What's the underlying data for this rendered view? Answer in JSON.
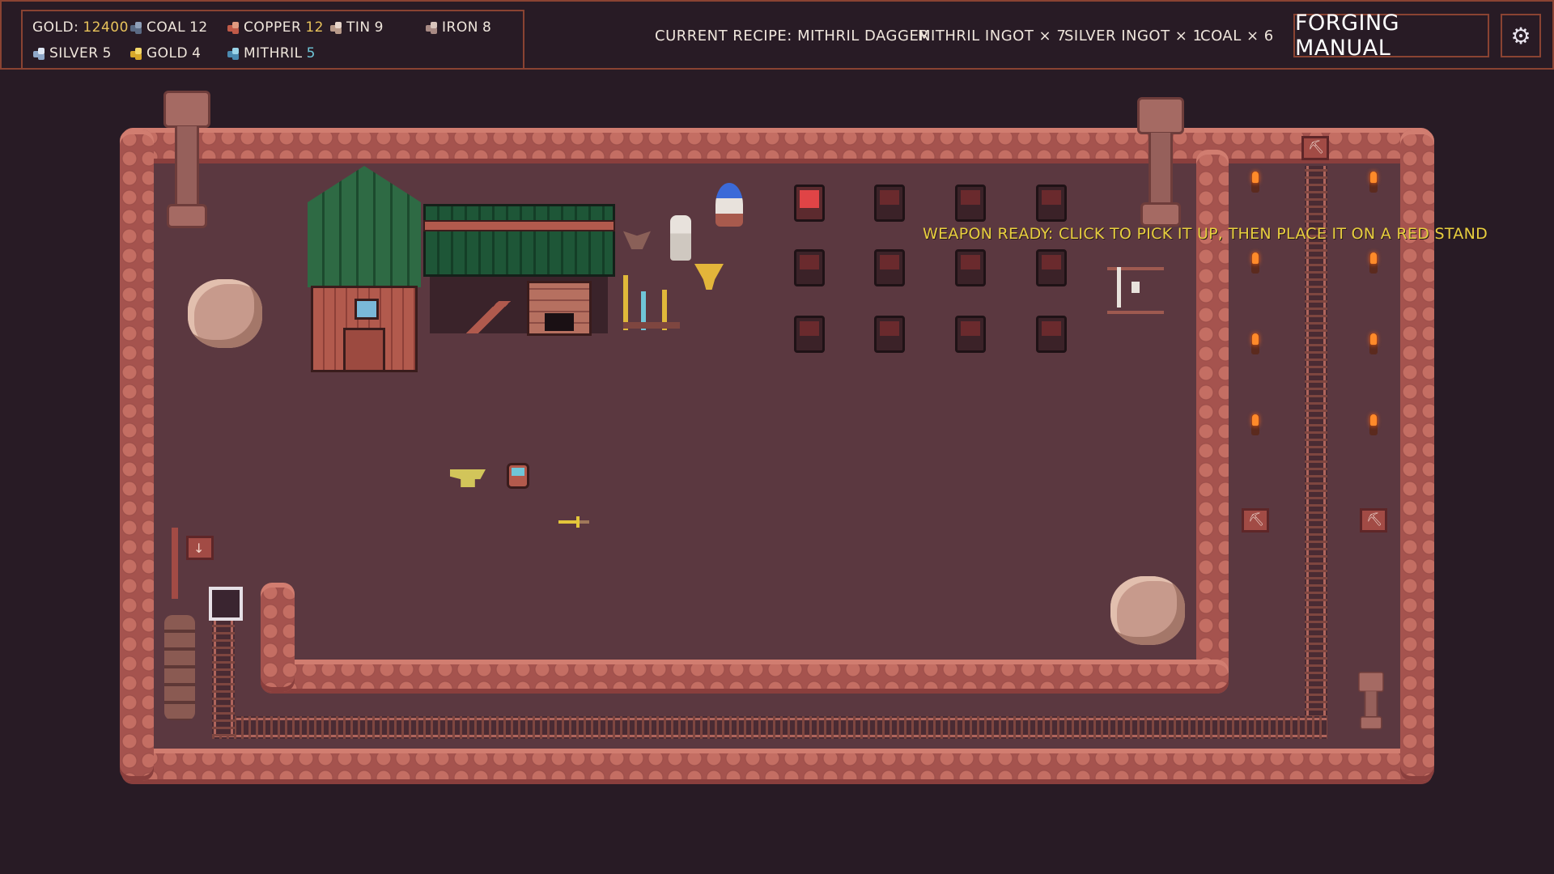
{
  "resources": {
    "gold": {
      "label": "GOLD:",
      "value": "12400"
    },
    "coal": {
      "label": "COAL",
      "value": "12"
    },
    "copper": {
      "label": "COPPER",
      "value": "12"
    },
    "tin": {
      "label": "TIN",
      "value": "9"
    },
    "iron": {
      "label": "IRON",
      "value": "8"
    },
    "silver": {
      "label": "SILVER",
      "value": "5"
    },
    "gold_ore": {
      "label": "GOLD",
      "value": "4"
    },
    "mithril": {
      "label": "MITHRIL",
      "value": "5"
    }
  },
  "recipe": {
    "current": "CURRENT RECIPE: MITHRIL DAGGER",
    "req1": "MITHRIL INGOT × 7",
    "req2": "SILVER INGOT × 1",
    "req3": "COAL × 6"
  },
  "buttons": {
    "manual": "FORGING MANUAL",
    "settings_icon": "gear-icon"
  },
  "tooltip": "WEAPON READY: CLICK TO PICK IT UP, THEN PLACE IT ON A RED STAND",
  "colors": {
    "accent_border": "#8a4332",
    "gold_value": "#e8c35b",
    "mithril_value": "#6fc6d8",
    "tooltip": "#e8cf3e",
    "active_stand": "#e04446"
  }
}
